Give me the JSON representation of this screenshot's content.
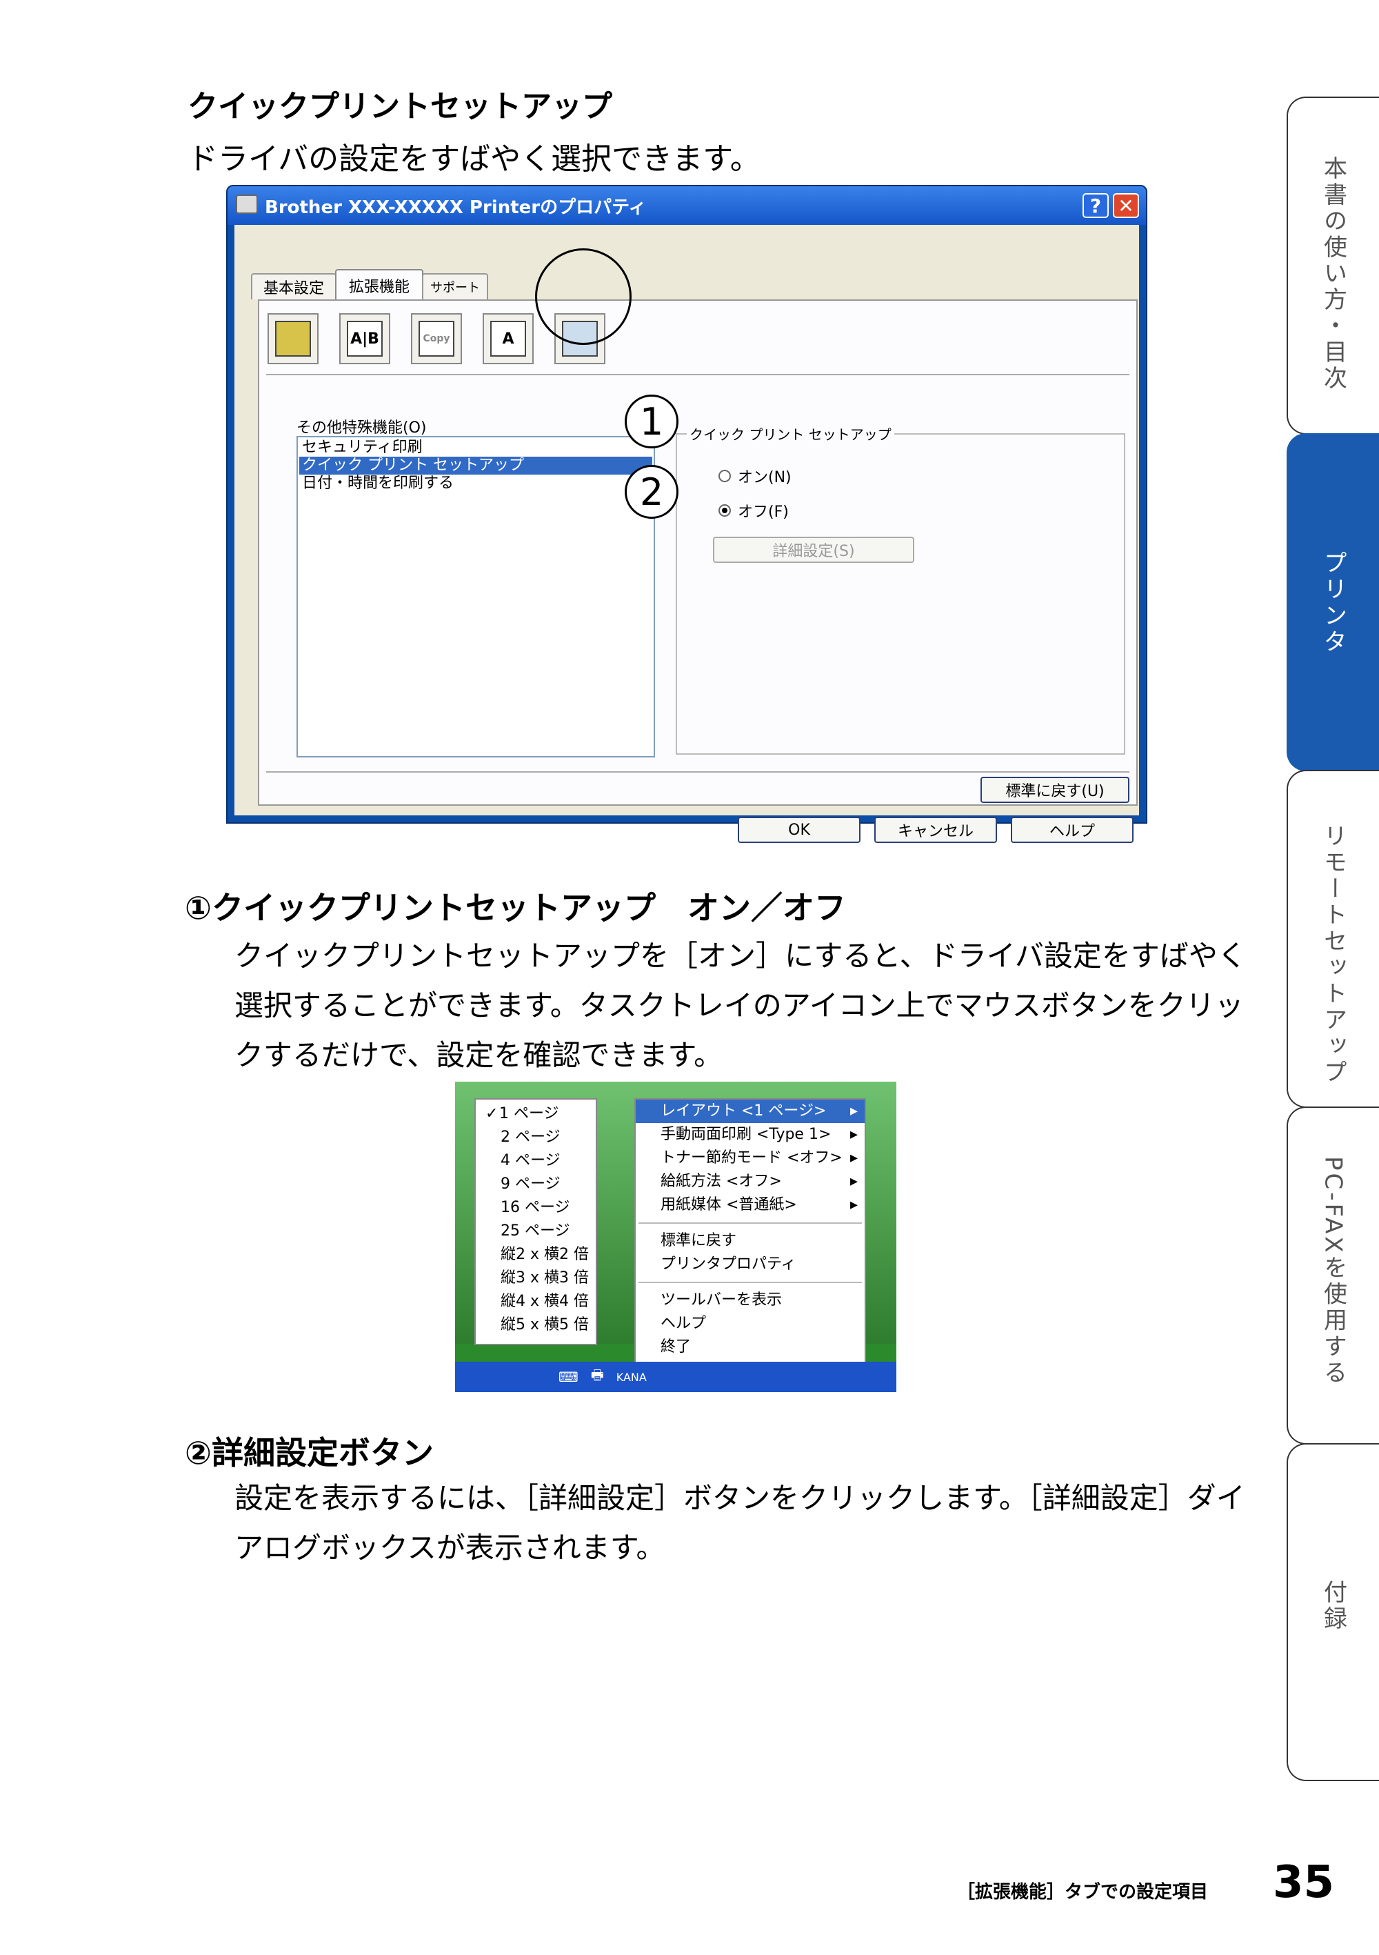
{
  "heading": {
    "title": "クイックプリントセットアップ",
    "description": "ドライバの設定をすばやく選択できます。"
  },
  "dialog": {
    "title": "Brother XXX-XXXXX Printerのプロパティ",
    "help_btn": "?",
    "close_btn": "✕",
    "tabs": [
      "基本設定",
      "拡張機能",
      "サポート"
    ],
    "icon_labels": [
      "A|B",
      "Copy",
      "A"
    ],
    "other_features_label": "その他特殊機能(O)",
    "features": [
      "セキュリティ印刷",
      "クイック プリント セットアップ",
      "日付・時間を印刷する"
    ],
    "group_label": "クイック プリント セットアップ",
    "radio_on": "オン(N)",
    "radio_off": "オフ(F)",
    "detail_btn": "詳細設定(S)",
    "default_btn": "標準に戻す(U)",
    "ok_btn": "OK",
    "cancel_btn": "キャンセル",
    "help_button": "ヘルプ"
  },
  "callouts": [
    "1",
    "2"
  ],
  "section1": {
    "title": "①クイックプリントセットアップ　オン／オフ",
    "body": "クイックプリントセットアップを［オン］にすると、ドライバ設定をすばやく選択することができます。タスクトレイのアイコン上でマウスボタンをクリックするだけで、設定を確認できます。"
  },
  "menu": {
    "left_items": [
      {
        "check": "✓",
        "label": "1 ページ"
      },
      {
        "check": "",
        "label": "2 ページ"
      },
      {
        "check": "",
        "label": "4 ページ"
      },
      {
        "check": "",
        "label": "9 ページ"
      },
      {
        "check": "",
        "label": "16 ページ"
      },
      {
        "check": "",
        "label": "25 ページ"
      },
      {
        "check": "",
        "label": "縦2 x 横2 倍"
      },
      {
        "check": "",
        "label": "縦3 x 横3 倍"
      },
      {
        "check": "",
        "label": "縦4 x 横4 倍"
      },
      {
        "check": "",
        "label": "縦5 x 横5 倍"
      }
    ],
    "right_items_1": [
      {
        "label": "レイアウト <1 ページ>",
        "arrow": "▸"
      },
      {
        "label": "手動両面印刷 <Type 1>",
        "arrow": "▸"
      },
      {
        "label": "トナー節約モード <オフ>",
        "arrow": "▸"
      },
      {
        "label": "給紙方法 <オフ>",
        "arrow": "▸"
      },
      {
        "label": "用紙媒体 <普通紙>",
        "arrow": "▸"
      }
    ],
    "right_items_2": [
      "標準に戻す",
      "プリンタプロパティ"
    ],
    "right_items_3": [
      "ツールバーを表示",
      "ヘルプ",
      "終了"
    ],
    "taskbar_text": "KANA"
  },
  "section2": {
    "title": "②詳細設定ボタン",
    "body": "設定を表示するには、［詳細設定］ボタンをクリックします。［詳細設定］ダイアログボックスが表示されます。"
  },
  "side_tabs": [
    "本書の使い方・目次",
    "プリンタ",
    "リモートセットアップ",
    "PC-FAXを使用する",
    "付録"
  ],
  "footer": {
    "section_name": "［拡張機能］タブでの設定項目",
    "page_number": "35"
  }
}
